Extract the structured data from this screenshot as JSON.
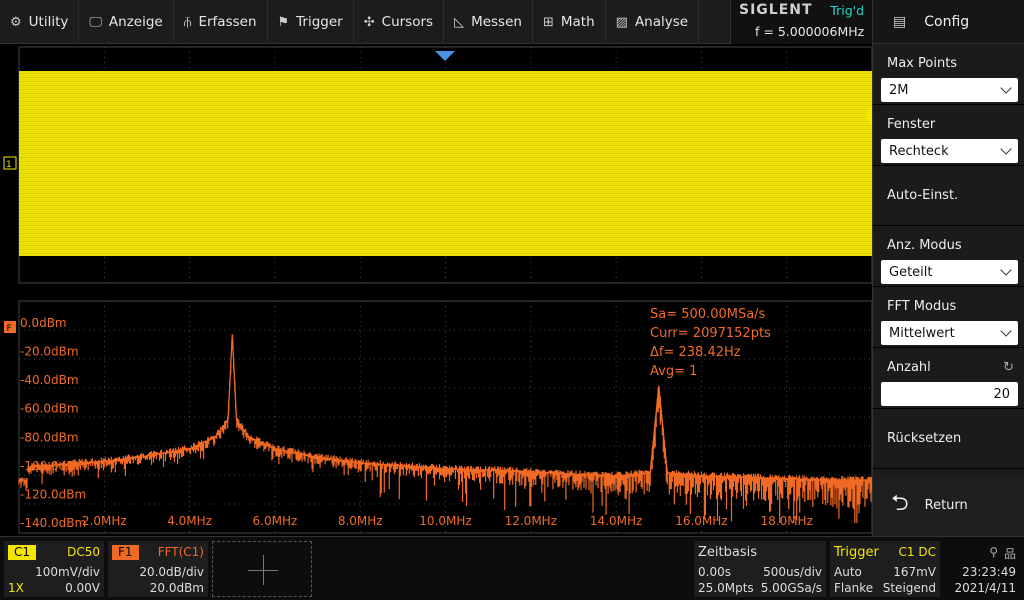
{
  "menu": [
    {
      "label": "Utility",
      "icon": "gear-icon",
      "glyph": "⚙"
    },
    {
      "label": "Anzeige",
      "icon": "monitor-icon",
      "glyph": "🖵"
    },
    {
      "label": "Erfassen",
      "icon": "acquire-icon",
      "glyph": "⫚"
    },
    {
      "label": "Trigger",
      "icon": "flag-icon",
      "glyph": "⚑"
    },
    {
      "label": "Cursors",
      "icon": "crosshair-icon",
      "glyph": "✣"
    },
    {
      "label": "Messen",
      "icon": "measure-icon",
      "glyph": "◺"
    },
    {
      "label": "Math",
      "icon": "math-icon",
      "glyph": "⊞"
    },
    {
      "label": "Analyse",
      "icon": "analyse-icon",
      "glyph": "▨"
    }
  ],
  "brand": {
    "name": "SIGLENT",
    "trigger_status": "Trig'd",
    "frequency": "f = 5.000006MHz"
  },
  "panel": {
    "title": "Config",
    "max_points": {
      "label": "Max Points",
      "value": "2M"
    },
    "fenster": {
      "label": "Fenster",
      "value": "Rechteck"
    },
    "auto_einst": "Auto-Einst.",
    "anz_modus": {
      "label": "Anz. Modus",
      "value": "Geteilt"
    },
    "fft_modus": {
      "label": "FFT Modus",
      "value": "Mittelwert"
    },
    "anzahl": {
      "label": "Anzahl",
      "value": "20"
    },
    "ruecksetzen": "Rücksetzen",
    "return": "Return"
  },
  "fft_info": {
    "sa": "Sa=  500.00MSa/s",
    "curr": "Curr= 2097152pts",
    "df": "Δf=  238.42Hz",
    "avg": "Avg= 1"
  },
  "chart_data": {
    "type": "line",
    "series": [
      {
        "x": [
          0.2,
          1.0,
          2.0,
          3.0,
          4.0,
          4.6,
          4.9,
          5.0,
          5.1,
          5.4,
          6.0,
          7.0,
          8.0,
          9.0,
          10.0,
          11.0,
          12.0,
          13.0,
          14.0,
          14.8,
          15.0,
          15.2,
          16.0,
          17.0,
          18.0,
          19.0,
          20.0
        ],
        "y": [
          -101,
          -99,
          -97,
          -93,
          -88,
          -80,
          -68,
          -8,
          -68,
          -80,
          -88,
          -94,
          -98,
          -100,
          -102,
          -103,
          -104,
          -106,
          -107,
          -105,
          -44,
          -105,
          -107,
          -108,
          -109,
          -110,
          -110
        ]
      }
    ],
    "y_ticks": [
      "0.0dBm",
      "-20.0dBm",
      "-40.0dBm",
      "-60.0dBm",
      "-80.0dBm",
      "-100.0dBm",
      "-120.0dBm",
      "-140.0dBm"
    ],
    "x_ticks": [
      "2.0MHz",
      "4.0MHz",
      "6.0MHz",
      "8.0MHz",
      "10.0MHz",
      "12.0MHz",
      "14.0MHz",
      "16.0MHz",
      "18.0MHz"
    ],
    "xlim": [
      0,
      20
    ],
    "ylim": [
      -140,
      0
    ],
    "grid": true,
    "trace_color": "#f06a25"
  },
  "colors": {
    "ch1": "#f5e600",
    "fft": "#f06a25",
    "trigger": "#1fd7c8",
    "marker": "#4a90e2"
  },
  "bottom": {
    "c1": {
      "tag": "C1",
      "coupling": "DC50",
      "vdiv": "100mV/div",
      "probe": "1X",
      "offset": "0.00V"
    },
    "f1": {
      "tag": "F1",
      "source": "FFT(C1)",
      "scale": "20.0dB/div",
      "ref": "20.0dBm"
    },
    "zeitbasis": {
      "title": "Zeitbasis",
      "delay": "0.00s",
      "tdiv": "500us/div",
      "mpts": "25.0Mpts",
      "srate": "5.00GSa/s"
    },
    "trigger": {
      "title": "Trigger",
      "src": "C1 DC",
      "mode": "Auto",
      "level": "167mV",
      "type": "Flanke",
      "slope": "Steigend"
    },
    "clock": {
      "time": "23:23:49",
      "date": "2021/4/11"
    }
  }
}
